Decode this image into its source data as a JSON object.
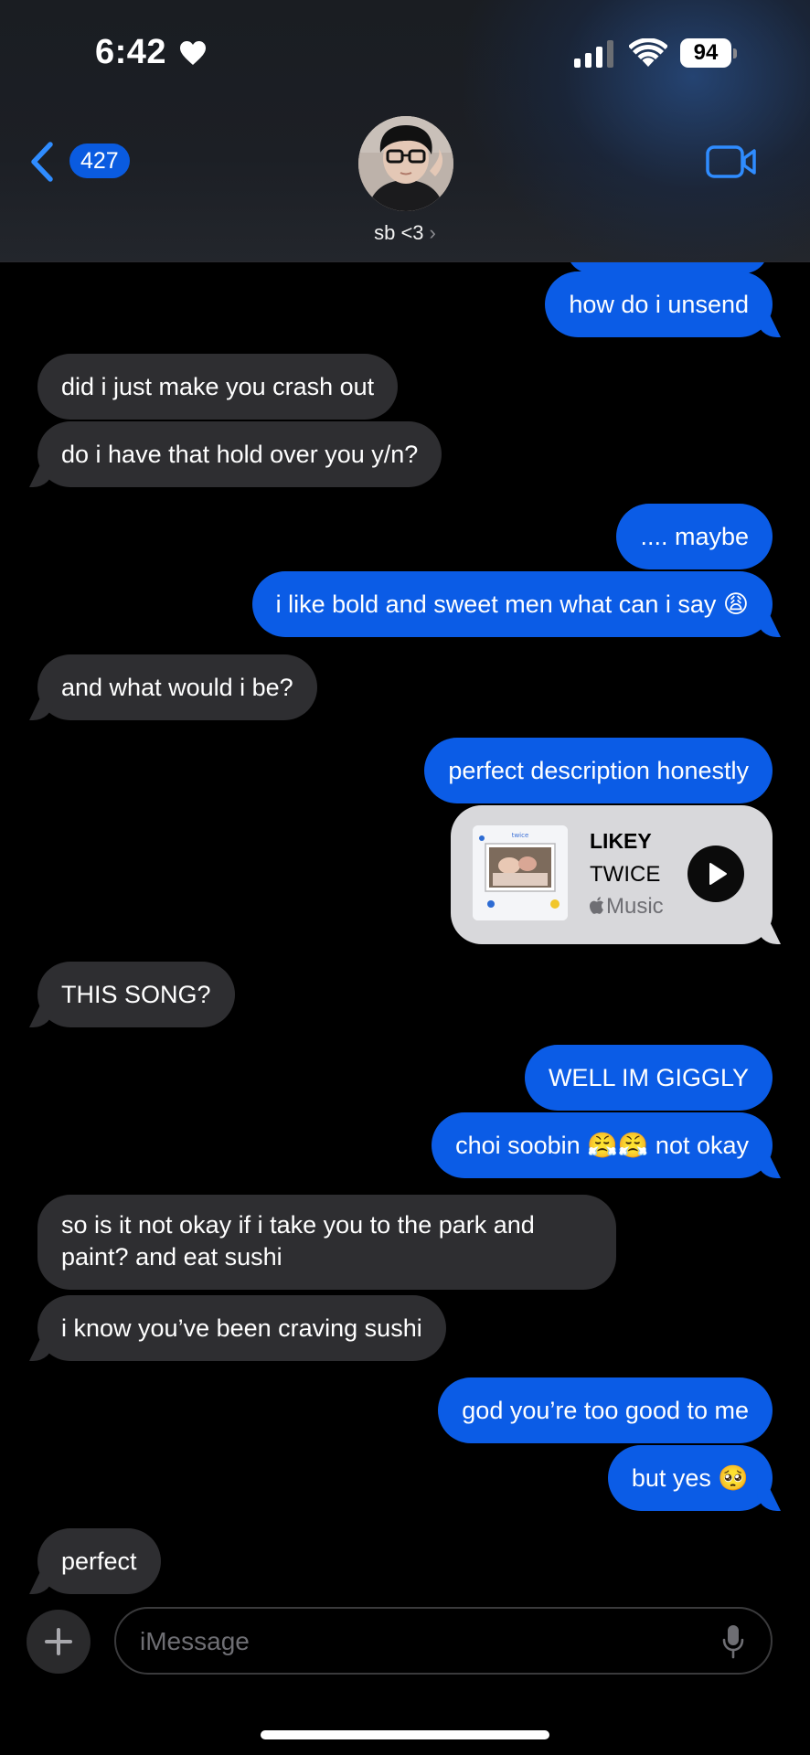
{
  "status_bar": {
    "time": "6:42",
    "battery": "94"
  },
  "header": {
    "back_count": "427",
    "contact_name": "sb <3"
  },
  "messages": [
    {
      "from": "me",
      "text": "how do i unsend"
    },
    {
      "from": "them",
      "text": "did i just make you crash out"
    },
    {
      "from": "them",
      "text": "do i have that hold over you y/n?"
    },
    {
      "from": "me",
      "text": ".... maybe"
    },
    {
      "from": "me",
      "text": "i like bold and sweet men what can i say 😩"
    },
    {
      "from": "them",
      "text": "and what would i be?"
    },
    {
      "from": "me",
      "text": "perfect description honestly"
    },
    {
      "from": "them",
      "text": "THIS SONG?"
    },
    {
      "from": "me",
      "text": "WELL IM GIGGLY"
    },
    {
      "from": "me",
      "text": "choi soobin 😤😤 not okay"
    },
    {
      "from": "them",
      "text": "so is it not okay if i take you to the park and paint? and eat sushi"
    },
    {
      "from": "them",
      "text": "i know you’ve been craving sushi"
    },
    {
      "from": "me",
      "text": "god you’re too good to me"
    },
    {
      "from": "me",
      "text": "but yes 🥺"
    },
    {
      "from": "them",
      "text": "perfect"
    }
  ],
  "music_card": {
    "title": "LIKEY",
    "artist": "TWICE",
    "service": "Music"
  },
  "composer": {
    "placeholder": "iMessage"
  },
  "colors": {
    "sent": "#0b5ce6",
    "received": "#2e2e31",
    "accent": "#2f8cff"
  }
}
